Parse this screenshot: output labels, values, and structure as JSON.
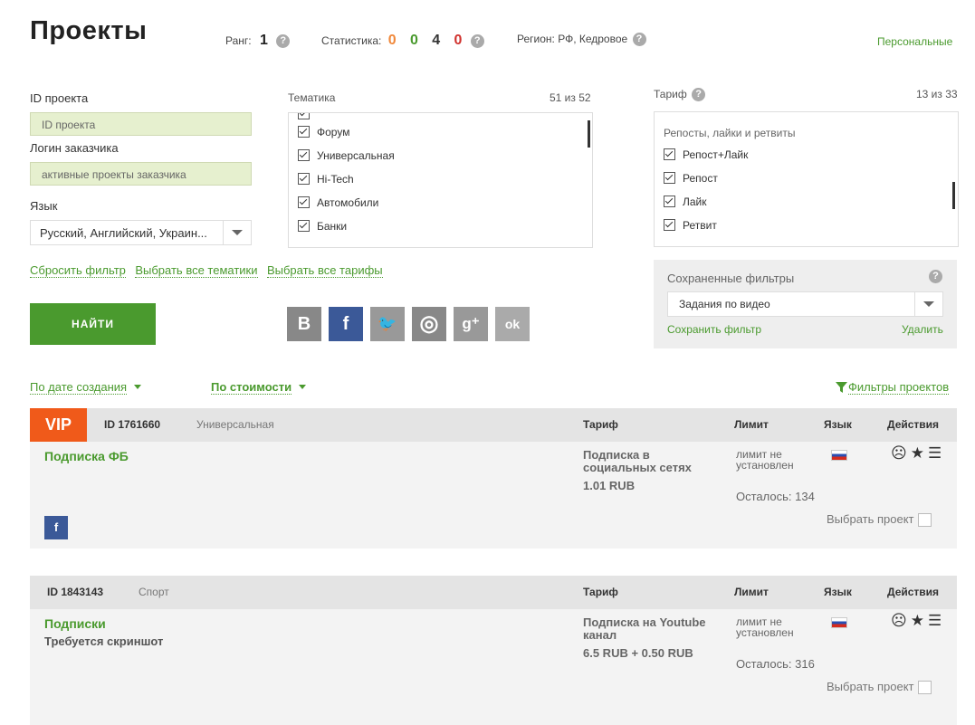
{
  "page": {
    "title": "Проекты",
    "personal_link": "Персональные"
  },
  "header": {
    "rank_label": "Ранг:",
    "rank_value": "1",
    "stats_label": "Статистика:",
    "stats": [
      {
        "value": "0",
        "color": "#f0883a"
      },
      {
        "value": "0",
        "color": "#4a9a2e"
      },
      {
        "value": "4",
        "color": "#333333"
      },
      {
        "value": "0",
        "color": "#d0312d"
      }
    ],
    "region_label": "Регион: РФ, Кедровое"
  },
  "filters": {
    "id_label": "ID проекта",
    "id_placeholder": "ID проекта",
    "login_label": "Логин заказчика",
    "login_placeholder": "активные проекты заказчика",
    "lang_label": "Язык",
    "lang_value": "Русский, Английский, Украин...",
    "topic_label": "Тематика",
    "topic_count": "51 из 52",
    "topics": [
      "Форум",
      "Универсальная",
      "Hi-Tech",
      "Автомобили",
      "Банки"
    ],
    "tariff_label": "Тариф",
    "tariff_count": "13 из 33",
    "tariff_group": "Репосты, лайки и ретвиты",
    "tariffs": [
      "Репост+Лайк",
      "Репост",
      "Лайк",
      "Ретвит"
    ],
    "reset_link": "Сбросить фильтр",
    "all_topics_link": "Выбрать все тематики",
    "all_tariffs_link": "Выбрать все тарифы",
    "find_button": "НАЙТИ",
    "socials": [
      {
        "icon": "vk-icon",
        "glyph": "В",
        "color": "#888888"
      },
      {
        "icon": "facebook-icon",
        "glyph": "f",
        "color": "#3b5998"
      },
      {
        "icon": "twitter-icon",
        "glyph": "🐦",
        "color": "#999999"
      },
      {
        "icon": "instagram-icon",
        "glyph": "◎",
        "color": "#888888"
      },
      {
        "icon": "googleplus-icon",
        "glyph": "g⁺",
        "color": "#999999"
      },
      {
        "icon": "odnoklassniki-icon",
        "glyph": "ok",
        "color": "#aaaaaa"
      }
    ]
  },
  "saved": {
    "title": "Сохраненные фильтры",
    "value": "Задания по видео",
    "save_link": "Сохранить фильтр",
    "delete_link": "Удалить"
  },
  "sort": {
    "by_date": "По дате создания",
    "by_cost": "По стоимости",
    "project_filters": "Фильтры проектов"
  },
  "columns": {
    "tariff": "Тариф",
    "limit": "Лимит",
    "lang": "Язык",
    "actions": "Действия"
  },
  "projects": [
    {
      "vip": "VIP",
      "id": "ID 1761660",
      "topic": "Универсальная",
      "name": "Подписка ФБ",
      "note": "",
      "tariff": "Подписка в социальных сетях",
      "price": "1.01 RUB",
      "limit": "лимит не установлен",
      "left": "Осталось: 134",
      "pick": "Выбрать проект"
    },
    {
      "vip": "",
      "id": "ID 1843143",
      "topic": "Спорт",
      "name": "Подписки",
      "note": "Требуется скриншот",
      "tariff": "Подписка на Youtube канал",
      "price": "6.5 RUB + 0.50 RUB",
      "limit": "лимит не установлен",
      "left": "Осталось: 316",
      "pick": "Выбрать проект"
    }
  ]
}
